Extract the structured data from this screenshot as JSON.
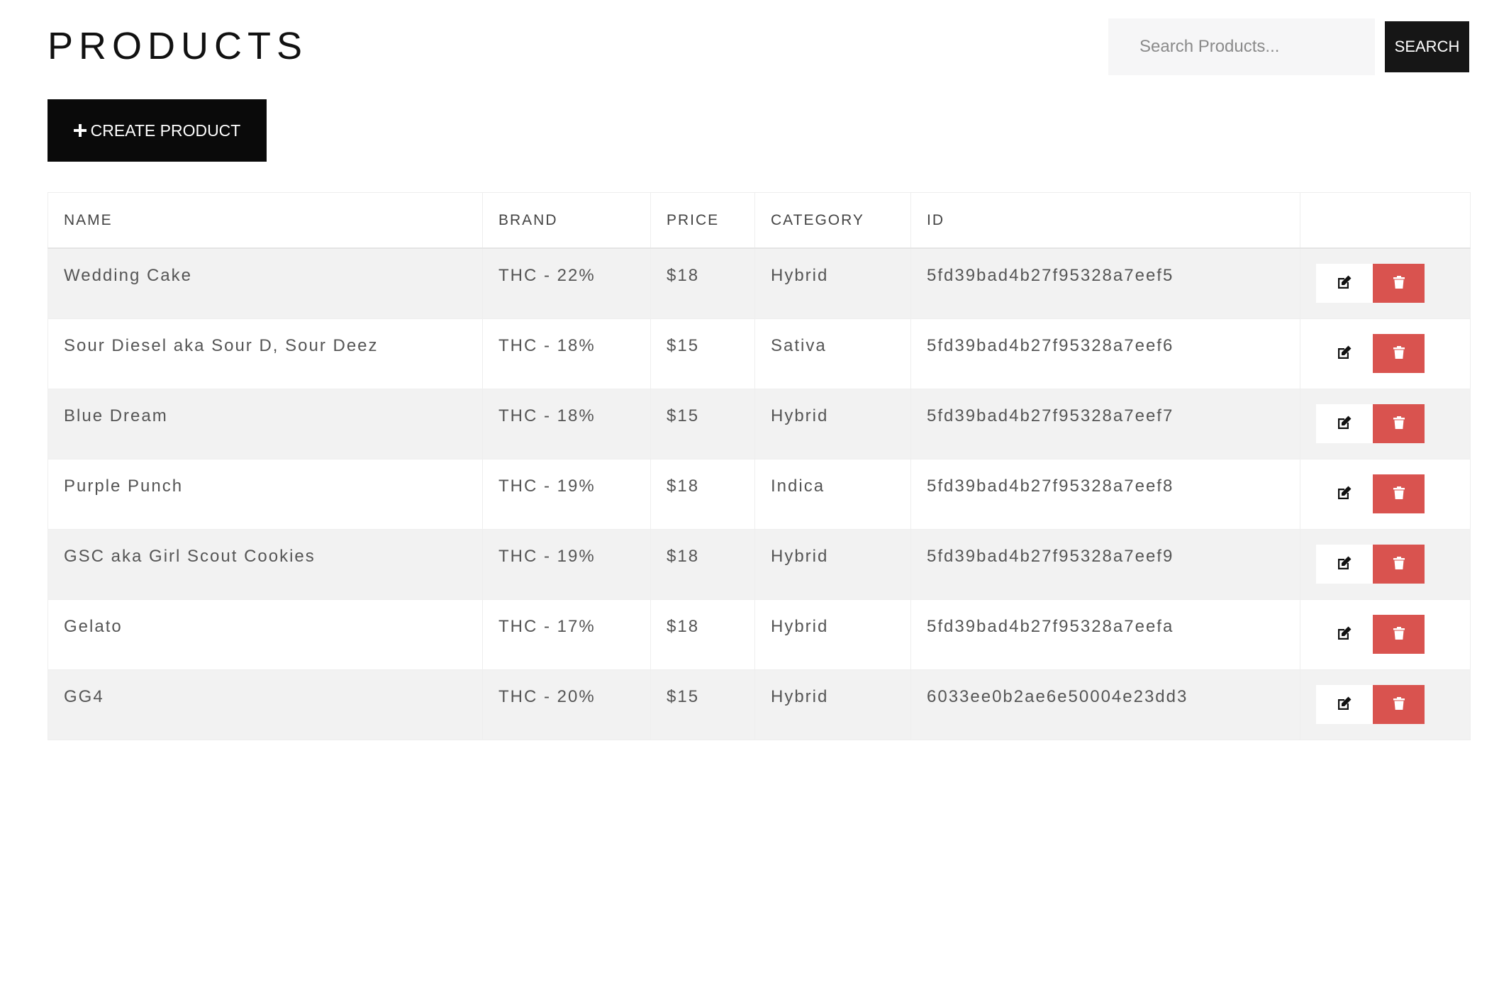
{
  "header": {
    "title": "PRODUCTS"
  },
  "search": {
    "placeholder": "Search Products...",
    "value": "",
    "button_label": "SEARCH"
  },
  "toolbar": {
    "create_label": "CREATE PRODUCT",
    "create_icon": "plus-icon"
  },
  "table": {
    "columns": [
      "NAME",
      "BRAND",
      "PRICE",
      "CATEGORY",
      "ID",
      ""
    ],
    "rows": [
      {
        "name": "Wedding Cake",
        "brand": "THC - 22%",
        "price": "$18",
        "category": "Hybrid",
        "id": "5fd39bad4b27f95328a7eef5"
      },
      {
        "name": "Sour Diesel aka Sour D, Sour Deez",
        "brand": "THC - 18%",
        "price": "$15",
        "category": "Sativa",
        "id": "5fd39bad4b27f95328a7eef6"
      },
      {
        "name": "Blue Dream",
        "brand": "THC - 18%",
        "price": "$15",
        "category": "Hybrid",
        "id": "5fd39bad4b27f95328a7eef7"
      },
      {
        "name": "Purple Punch",
        "brand": "THC - 19%",
        "price": "$18",
        "category": "Indica",
        "id": "5fd39bad4b27f95328a7eef8"
      },
      {
        "name": "GSC aka Girl Scout Cookies",
        "brand": "THC - 19%",
        "price": "$18",
        "category": "Hybrid",
        "id": "5fd39bad4b27f95328a7eef9"
      },
      {
        "name": "Gelato",
        "brand": "THC - 17%",
        "price": "$18",
        "category": "Hybrid",
        "id": "5fd39bad4b27f95328a7eefa"
      },
      {
        "name": "GG4",
        "brand": "THC - 20%",
        "price": "$15",
        "category": "Hybrid",
        "id": "6033ee0b2ae6e50004e23dd3"
      }
    ],
    "row_actions": {
      "edit_icon": "edit-icon",
      "delete_icon": "trash-icon"
    }
  },
  "colors": {
    "primary_button": "#0a0a0a",
    "delete_button": "#d9534f",
    "row_stripe": "#f2f2f2",
    "search_background": "#f6f6f7"
  }
}
